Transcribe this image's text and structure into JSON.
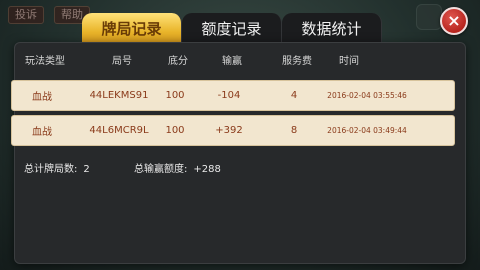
{
  "background": {
    "top_buttons": [
      "投诉",
      "帮助"
    ]
  },
  "tabs": [
    {
      "label": "牌局记录",
      "active": true
    },
    {
      "label": "额度记录",
      "active": false
    },
    {
      "label": "数据统计",
      "active": false
    }
  ],
  "close_icon": "×",
  "table": {
    "headers": [
      "玩法类型",
      "局号",
      "底分",
      "输赢",
      "服务费",
      "时间"
    ],
    "rows": [
      [
        "血战",
        "44LEKMS91",
        "100",
        "-104",
        "4",
        "2016-02-04 03:55:46"
      ],
      [
        "血战",
        "44L6MCR9L",
        "100",
        "+392",
        "8",
        "2016-02-04 03:49:44"
      ]
    ]
  },
  "summary": {
    "total_games_label": "总计牌局数:",
    "total_games_value": "2",
    "total_win_label": "总输赢额度:",
    "total_win_value": "+288"
  },
  "colors": {
    "active_tab": "#e9b52b",
    "row_bg": "#f2e6cf",
    "row_text": "#8a3a1a",
    "close_button": "#c0302a"
  }
}
